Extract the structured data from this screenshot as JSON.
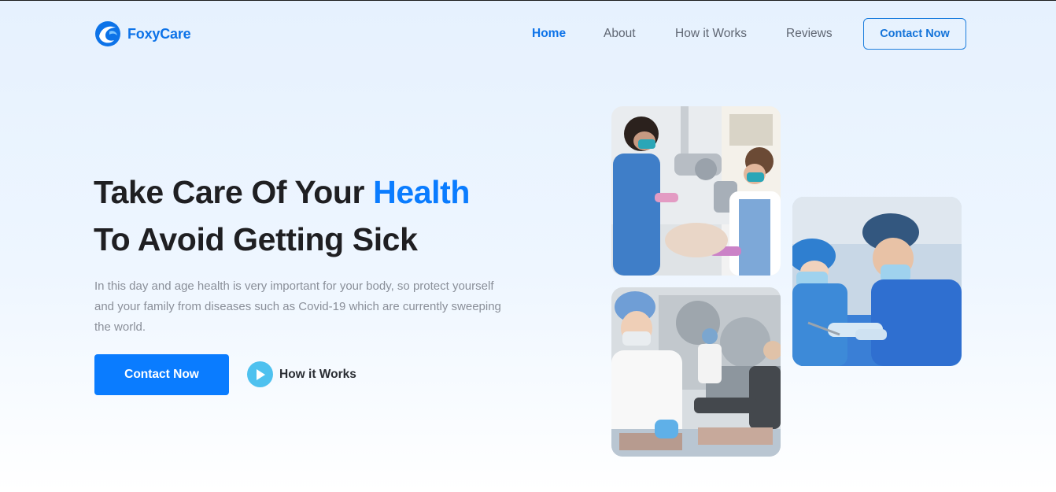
{
  "brand": {
    "name": "FoxyCare"
  },
  "nav": {
    "items": [
      {
        "label": "Home",
        "active": true
      },
      {
        "label": "About",
        "active": false
      },
      {
        "label": "How it Works",
        "active": false
      },
      {
        "label": "Reviews",
        "active": false
      }
    ],
    "cta_label": "Contact Now"
  },
  "hero": {
    "title_line1_plain": "Take Care Of Your",
    "title_line1_accent": "Health",
    "title_line2": "To Avoid Getting Sick",
    "description": "In this day and age health is very important for your body, so protect yourself and your family from diseases such as Covid-19 which are currently sweeping the world.",
    "primary_button": "Contact Now",
    "secondary_link": "How it Works"
  },
  "colors": {
    "accent": "#0a7cff",
    "play": "#4ec1ef",
    "heading": "#1f1f22",
    "body_text": "#8a8f99"
  },
  "gallery": {
    "images": [
      "dental-exam-photo",
      "surgery-photo",
      "lab-technician-photo"
    ]
  }
}
